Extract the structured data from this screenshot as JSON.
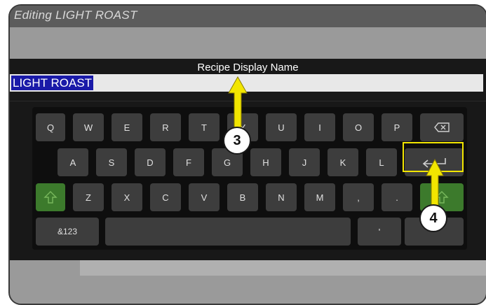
{
  "window": {
    "title": "Editing LIGHT ROAST"
  },
  "field": {
    "label": "Recipe Display Name",
    "value": "LIGHT ROAST"
  },
  "keyboard": {
    "row1": [
      "Q",
      "W",
      "E",
      "R",
      "T",
      "Y",
      "U",
      "I",
      "O",
      "P"
    ],
    "row2": [
      "A",
      "S",
      "D",
      "F",
      "G",
      "H",
      "J",
      "K",
      "L"
    ],
    "row3": [
      "Z",
      "X",
      "C",
      "V",
      "B",
      "N",
      "M",
      ",",
      "."
    ],
    "mode_key": "&123",
    "apostrophe_key": "'",
    "icons": {
      "backspace": "backspace-icon",
      "enter": "enter-icon",
      "shift": "shift-icon"
    }
  },
  "callouts": {
    "step_3": "3",
    "step_4": "4"
  },
  "colors": {
    "highlight": "#f2e600",
    "selection": "#1a1aa8",
    "shift_key": "#3c7a2c"
  }
}
